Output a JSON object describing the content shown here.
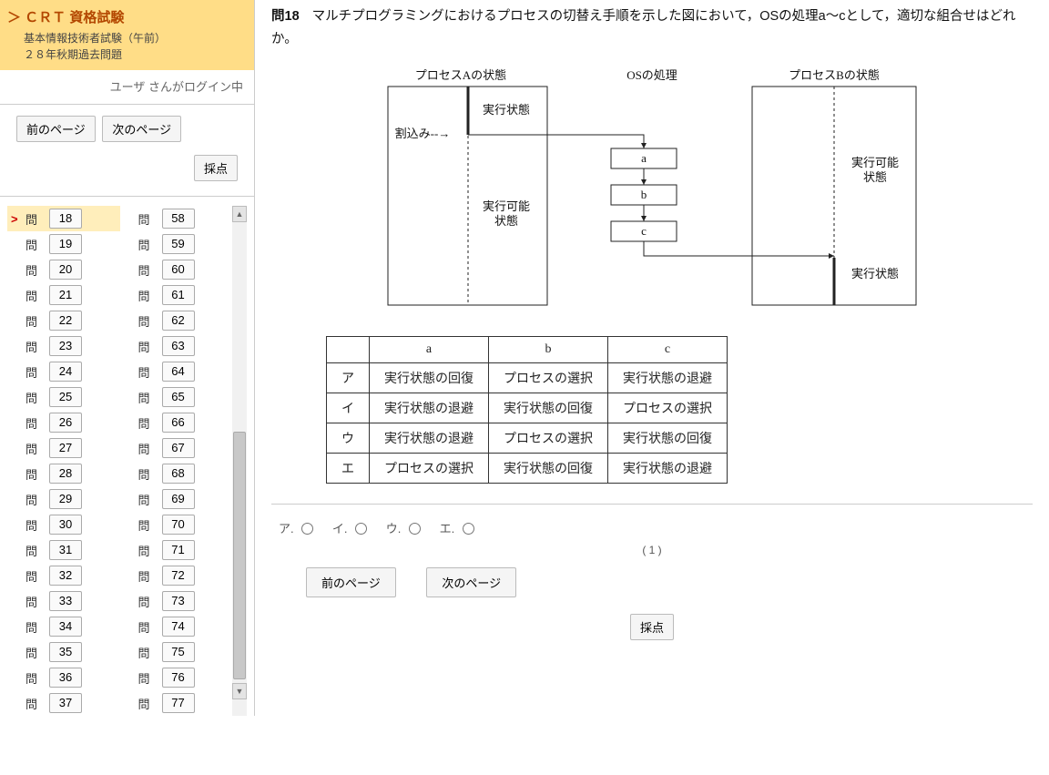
{
  "sidebar": {
    "title": "＞ ＣＲＴ 資格試験",
    "sub1": "基本情報技術者試験（午前）",
    "sub2": "２８年秋期過去問題",
    "login": "ユーザ さんがログイン中",
    "prev": "前のページ",
    "next": "次のページ",
    "score": "採点",
    "item_label": "問",
    "mark": ">",
    "col1": [
      18,
      19,
      20,
      21,
      22,
      23,
      24,
      25,
      26,
      27,
      28,
      29,
      30,
      31,
      32,
      33,
      34,
      35,
      36,
      37
    ],
    "col2": [
      58,
      59,
      60,
      61,
      62,
      63,
      64,
      65,
      66,
      67,
      68,
      69,
      70,
      71,
      72,
      73,
      74,
      75,
      76,
      77
    ],
    "current": 18
  },
  "question": {
    "number": "問18",
    "text": "マルチプログラミングにおけるプロセスの切替え手順を示した図において，OSの処理a〜cとして，適切な組合せはどれか。"
  },
  "diagram": {
    "labelA": "プロセスAの状態",
    "labelOS": "OSの処理",
    "labelB": "プロセスBの状態",
    "run": "実行状態",
    "ready": "実行可能\n状態",
    "ready2": "実行可能\n状態",
    "run2": "実行状態",
    "interrupt": "割込み--→",
    "a": "a",
    "b": "b",
    "c": "c"
  },
  "table": {
    "head": [
      "",
      "a",
      "b",
      "c"
    ],
    "rows": [
      [
        "ア",
        "実行状態の回復",
        "プロセスの選択",
        "実行状態の退避"
      ],
      [
        "イ",
        "実行状態の退避",
        "実行状態の回復",
        "プロセスの選択"
      ],
      [
        "ウ",
        "実行状態の退避",
        "プロセスの選択",
        "実行状態の回復"
      ],
      [
        "エ",
        "プロセスの選択",
        "実行状態の回復",
        "実行状態の退避"
      ]
    ]
  },
  "options": {
    "labels": [
      "ア.",
      "イ.",
      "ウ.",
      "エ."
    ]
  },
  "counter": "( 1 )",
  "mainbtn": {
    "prev": "前のページ",
    "next": "次のページ",
    "score": "採点"
  }
}
